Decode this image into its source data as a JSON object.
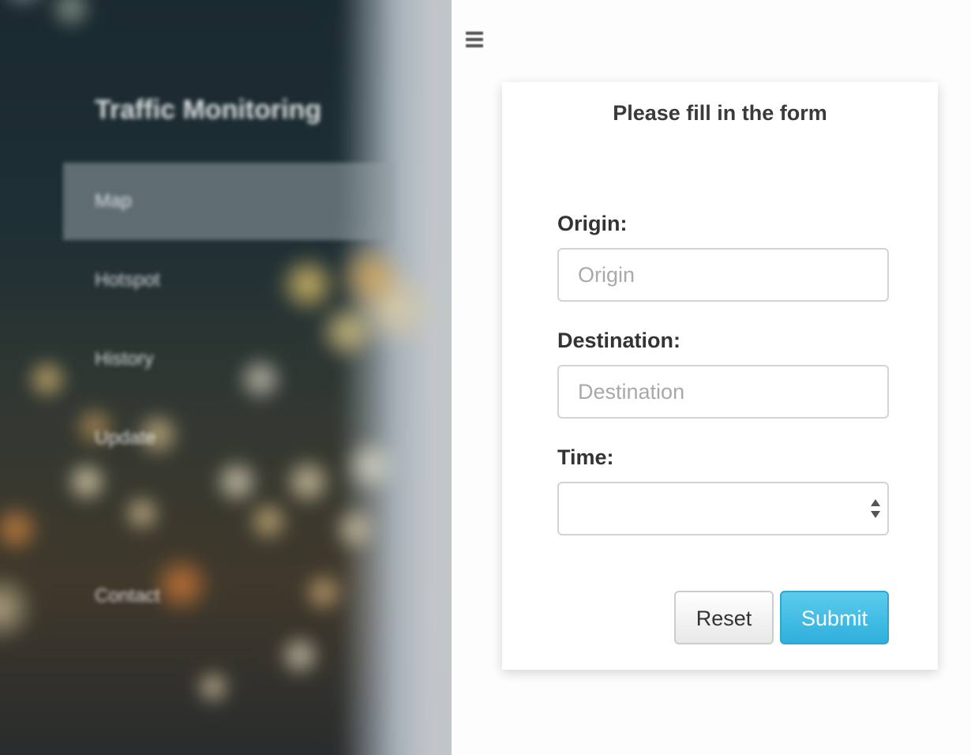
{
  "sidebar": {
    "brand": "Traffic Monitoring",
    "items": [
      {
        "label": "Map",
        "active": true
      },
      {
        "label": "Hotspot",
        "active": false
      },
      {
        "label": "History",
        "active": false
      },
      {
        "label": "Update",
        "active": false
      },
      {
        "label": "Contact",
        "active": false
      }
    ]
  },
  "menu_toggle": {
    "icon": "hamburger-menu-icon"
  },
  "form": {
    "title": "Please fill in the form",
    "origin": {
      "label": "Origin:",
      "placeholder": "Origin",
      "value": ""
    },
    "destination": {
      "label": "Destination:",
      "placeholder": "Destination",
      "value": ""
    },
    "time": {
      "label": "Time:",
      "value": ""
    },
    "buttons": {
      "reset": "Reset",
      "submit": "Submit"
    }
  },
  "colors": {
    "submit_bg": "#3bbde4",
    "text_dark": "#333333",
    "placeholder": "#a9a9a9"
  }
}
